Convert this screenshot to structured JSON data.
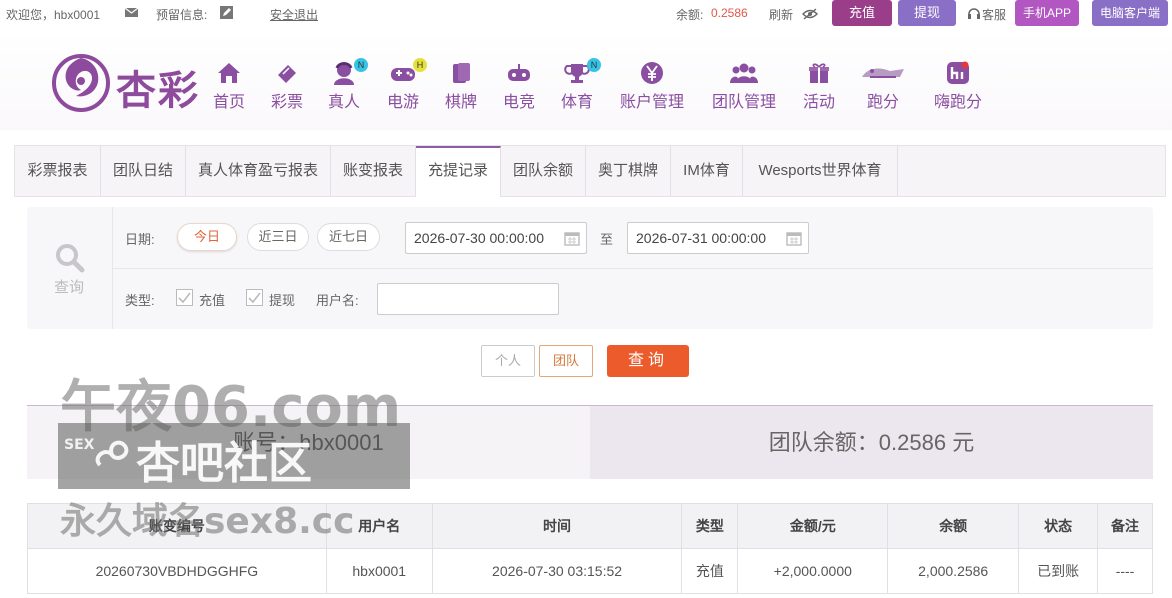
{
  "topbar": {
    "welcome": "欢迎您，hbx0001",
    "reserved_label": "预留信息:",
    "logout": "安全退出",
    "balance_label": "余额:",
    "balance_value": "0.2586",
    "refresh": "刷新",
    "deposit": "充值",
    "withdraw": "提现",
    "service": "客服",
    "mobile_app": "手机APP",
    "pc_client": "电脑客户端"
  },
  "logo": {
    "text": "杏彩"
  },
  "nav": [
    {
      "label": "首页",
      "icon": "home-icon"
    },
    {
      "label": "彩票",
      "icon": "ticket-icon"
    },
    {
      "label": "真人",
      "icon": "live-dealer-icon",
      "badge": "N"
    },
    {
      "label": "电游",
      "icon": "gamepad-icon",
      "badge": "H"
    },
    {
      "label": "棋牌",
      "icon": "cards-icon"
    },
    {
      "label": "电竞",
      "icon": "esports-icon"
    },
    {
      "label": "体育",
      "icon": "trophy-icon",
      "badge": "N"
    },
    {
      "label": "账户管理",
      "icon": "yen-icon"
    },
    {
      "label": "团队管理",
      "icon": "team-icon"
    },
    {
      "label": "活动",
      "icon": "gift-icon"
    },
    {
      "label": "跑分",
      "icon": "running-icon"
    },
    {
      "label": "嗨跑分",
      "icon": "hi-icon"
    }
  ],
  "tabs": [
    "彩票报表",
    "团队日结",
    "真人体育盈亏报表",
    "账变报表",
    "充提记录",
    "团队余额",
    "奥丁棋牌",
    "IM体育",
    "Wesports世界体育"
  ],
  "query": {
    "side_label": "查询",
    "date_label": "日期:",
    "quick": [
      "今日",
      "近三日",
      "近七日"
    ],
    "start": "2026-07-30 00:00:00",
    "to": "至",
    "end": "2026-07-31 00:00:00",
    "type_label": "类型:",
    "type_deposit": "充值",
    "type_withdraw": "提现",
    "username_label": "用户名:"
  },
  "actions": {
    "personal": "个人",
    "team": "团队",
    "search": "查询"
  },
  "account": {
    "account_text": "账号：hbx0001",
    "team_balance_text": "团队余额：0.2586 元"
  },
  "table": {
    "headers": [
      "账变编号",
      "用户名",
      "时间",
      "类型",
      "金额/元",
      "余额",
      "状态",
      "备注"
    ],
    "rows": [
      [
        "20260730VBDHDGGHFG",
        "hbx0001",
        "2026-07-30 03:15:52",
        "充值",
        "+2,000.0000",
        "2,000.2586",
        "已到账",
        "----"
      ]
    ]
  },
  "watermark": {
    "line1": "午夜06.com",
    "line2_prefix": "SEX",
    "line2": "杏吧社区",
    "line3": "永久域名sex8.cc"
  },
  "colors": {
    "accent": "#8a4fa0",
    "deposit_btn": "#9a3e8a",
    "withdraw_btn": "#8a6fc6",
    "search_btn": "#ec5b2c",
    "positive": "#3b9b3b"
  }
}
